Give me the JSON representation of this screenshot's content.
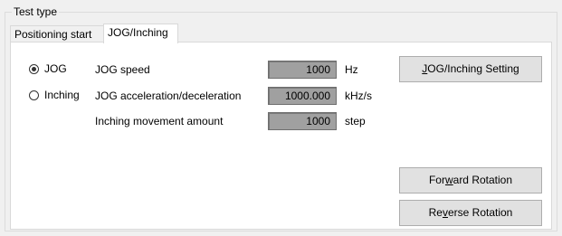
{
  "group": {
    "title": "Test type"
  },
  "tabs": [
    {
      "label": "Positioning start"
    },
    {
      "label": "JOG/Inching"
    }
  ],
  "mode": {
    "jog": {
      "label": "JOG",
      "selected": true
    },
    "inching": {
      "label": "Inching",
      "selected": false
    }
  },
  "params": [
    {
      "label": "JOG speed",
      "value": "1000",
      "unit": "Hz"
    },
    {
      "label": "JOG acceleration/deceleration",
      "value": "1000.000",
      "unit": "kHz/s"
    },
    {
      "label": "Inching movement amount",
      "value": "1000",
      "unit": "step"
    }
  ],
  "buttons": {
    "setting": {
      "pre": "",
      "mnemonic": "J",
      "post": "OG/Inching Setting"
    },
    "forward": {
      "pre": "For",
      "mnemonic": "w",
      "post": "ard Rotation"
    },
    "reverse": {
      "pre": "Re",
      "mnemonic": "v",
      "post": "erse Rotation"
    }
  }
}
